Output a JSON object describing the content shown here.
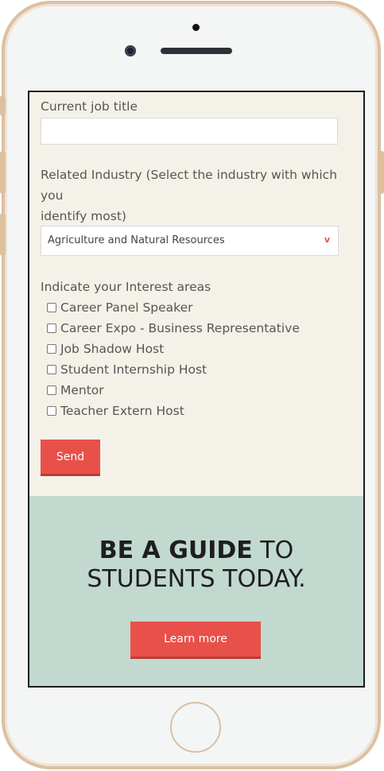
{
  "form": {
    "job_title_label": "Current job title",
    "job_title_value": "",
    "industry_label_line1": "Related Industry (Select the industry with which you",
    "industry_label_line2": "identify most)",
    "industry_selected": "Agriculture and Natural Resources",
    "industry_caret": "v",
    "interests_label": "Indicate your Interest areas",
    "interests": [
      {
        "label": "Career Panel Speaker",
        "checked": false
      },
      {
        "label": "Career Expo - Business Representative",
        "checked": false
      },
      {
        "label": "Job Shadow Host",
        "checked": false
      },
      {
        "label": "Student Internship Host",
        "checked": false
      },
      {
        "label": "Mentor",
        "checked": false
      },
      {
        "label": "Teacher Extern Host",
        "checked": false
      }
    ],
    "send_label": "Send"
  },
  "banner": {
    "title_bold": "BE A GUIDE",
    "title_rest": " TO",
    "title_line2": "STUDENTS TODAY.",
    "button_label": "Learn more"
  },
  "colors": {
    "accent": "#e8504a",
    "form_background": "#f4f2e8",
    "banner_background": "#c2d9cf",
    "phone_frame": "#dcc0a0"
  }
}
